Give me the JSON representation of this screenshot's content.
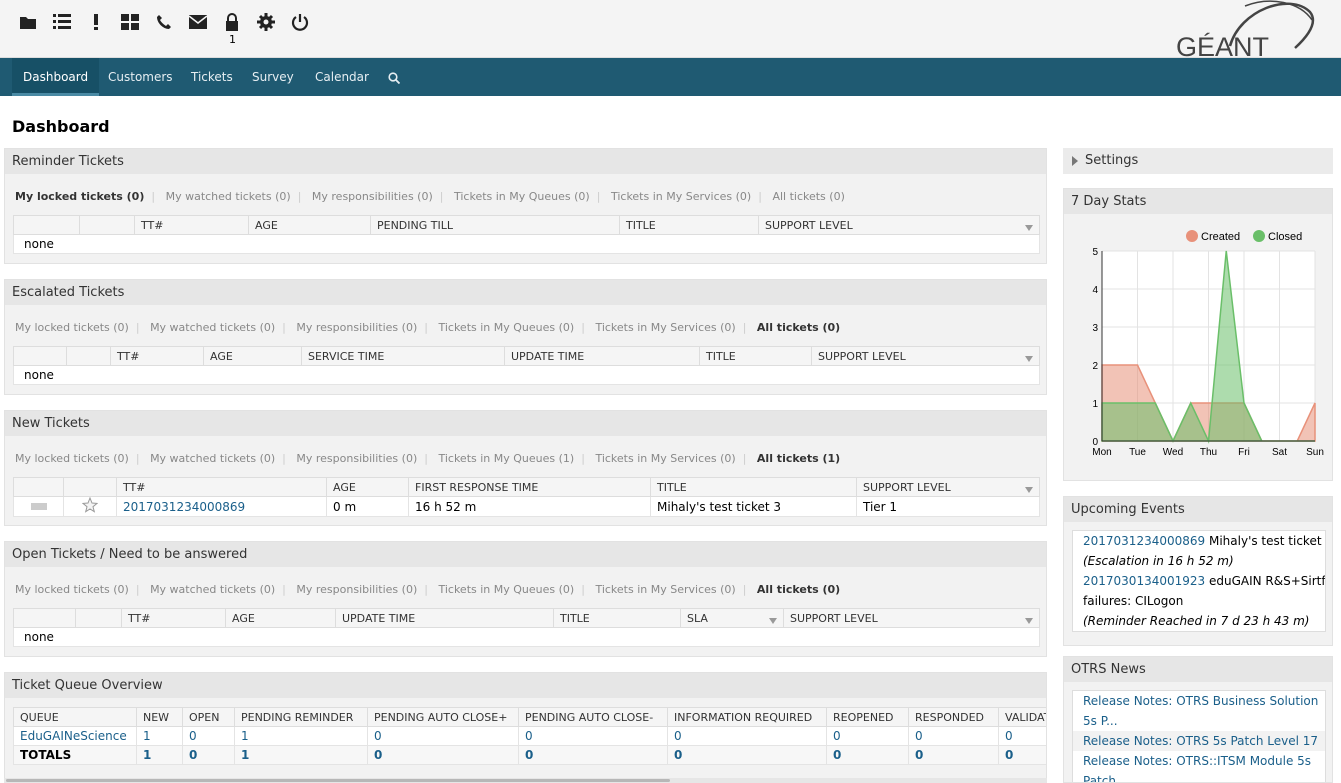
{
  "toolbar": {
    "icons": [
      "folder-icon",
      "queue-list-icon",
      "exclamation-icon",
      "dashboard-grid-icon",
      "phone-icon",
      "email-icon",
      "lock-icon",
      "gear-icon",
      "power-icon"
    ],
    "locked_count": "1"
  },
  "logo": {
    "text": "GÉANT"
  },
  "nav": {
    "items": [
      "Dashboard",
      "Customers",
      "Tickets",
      "Survey",
      "Calendar"
    ],
    "active": "Dashboard"
  },
  "page": {
    "title": "Dashboard"
  },
  "reminder": {
    "title": "Reminder Tickets",
    "filters": [
      "My locked tickets (0)",
      "My watched tickets (0)",
      "My responsibilities (0)",
      "Tickets in My Queues (0)",
      "Tickets in My Services (0)",
      "All tickets (0)"
    ],
    "columns": [
      "",
      "",
      "TT#",
      "AGE",
      "PENDING TILL",
      "TITLE",
      "SUPPORT LEVEL"
    ],
    "empty": "none"
  },
  "escalated": {
    "title": "Escalated Tickets",
    "filters": [
      "My locked tickets (0)",
      "My watched tickets (0)",
      "My responsibilities (0)",
      "Tickets in My Queues (0)",
      "Tickets in My Services (0)",
      "All tickets (0)"
    ],
    "columns": [
      "",
      "",
      "TT#",
      "AGE",
      "SERVICE TIME",
      "UPDATE TIME",
      "TITLE",
      "SUPPORT LEVEL"
    ],
    "empty": "none"
  },
  "new_tickets": {
    "title": "New Tickets",
    "filters": [
      "My locked tickets (0)",
      "My watched tickets (0)",
      "My responsibilities (0)",
      "Tickets in My Queues (1)",
      "Tickets in My Services (0)",
      "All tickets (1)"
    ],
    "columns": [
      "",
      "",
      "TT#",
      "AGE",
      "FIRST RESPONSE TIME",
      "TITLE",
      "SUPPORT LEVEL"
    ],
    "row": {
      "tt": "2017031234000869",
      "age": "0 m",
      "first_response": "16 h 52 m",
      "title": "Mihaly's test ticket 3",
      "support": "Tier 1"
    }
  },
  "open_tickets": {
    "title": "Open Tickets / Need to be answered",
    "filters": [
      "My locked tickets (0)",
      "My watched tickets (0)",
      "My responsibilities (0)",
      "Tickets in My Queues (0)",
      "Tickets in My Services (0)",
      "All tickets (0)"
    ],
    "columns": [
      "",
      "",
      "TT#",
      "AGE",
      "UPDATE TIME",
      "TITLE",
      "SLA",
      "SUPPORT LEVEL"
    ],
    "empty": "none"
  },
  "queue_overview": {
    "title": "Ticket Queue Overview",
    "columns": [
      "QUEUE",
      "NEW",
      "OPEN",
      "PENDING REMINDER",
      "PENDING AUTO CLOSE+",
      "PENDING AUTO CLOSE-",
      "INFORMATION REQUIRED",
      "REOPENED",
      "RESPONDED",
      "VALIDAT"
    ],
    "rows": [
      [
        "EduGAINeScience",
        "1",
        "0",
        "1",
        "0",
        "0",
        "0",
        "0",
        "0",
        "0"
      ],
      [
        "TOTALS",
        "1",
        "0",
        "1",
        "0",
        "0",
        "0",
        "0",
        "0",
        "0"
      ]
    ]
  },
  "settings": {
    "label": "Settings"
  },
  "stats": {
    "title": "7 Day Stats",
    "legend": [
      "Created",
      "Closed"
    ]
  },
  "chart_data": {
    "type": "area",
    "title": "7 Day Stats",
    "categories": [
      "Mon",
      "Tue",
      "Wed",
      "Thu",
      "Fri",
      "Sat",
      "Sun"
    ],
    "x_points": [
      0,
      0.5,
      1,
      1.5,
      2,
      2.5,
      3,
      3.5,
      4,
      4.5,
      5,
      5.5,
      6
    ],
    "series": [
      {
        "name": "Created",
        "color": "#e8917a",
        "values": [
          2,
          2,
          2,
          1,
          0,
          1,
          1,
          1,
          1,
          0,
          0,
          0,
          1
        ]
      },
      {
        "name": "Closed",
        "color": "#6abf69",
        "values": [
          1,
          1,
          1,
          1,
          0,
          1,
          0,
          5,
          1,
          0,
          0,
          0,
          0
        ]
      }
    ],
    "ylim": [
      0,
      5
    ],
    "yticks": [
      "0",
      "1",
      "2",
      "3",
      "4",
      "5"
    ],
    "legend_position": "top-right",
    "grid": true
  },
  "events": {
    "title": "Upcoming Events",
    "items": [
      {
        "id": "2017031234000869",
        "text": "Mihaly's test ticket 3",
        "note": "(Escalation in 16 h 52 m)"
      },
      {
        "id": "2017030134001923",
        "text": "eduGAIN R&S+Sirtfi",
        "text2": "failures: CILogon",
        "note": "(Reminder Reached in 7 d 23 h 43 m)"
      }
    ]
  },
  "news": {
    "title": "OTRS News",
    "items": [
      "Release Notes: OTRS Business Solution",
      "5s P...",
      "Release Notes: OTRS 5s Patch Level 17",
      "Release Notes: OTRS::ITSM Module 5s",
      "Patch..."
    ]
  },
  "colors": {
    "nav": "#1f5a72",
    "link": "#1a5f8a",
    "created": "#e8917a",
    "closed": "#6abf69"
  }
}
